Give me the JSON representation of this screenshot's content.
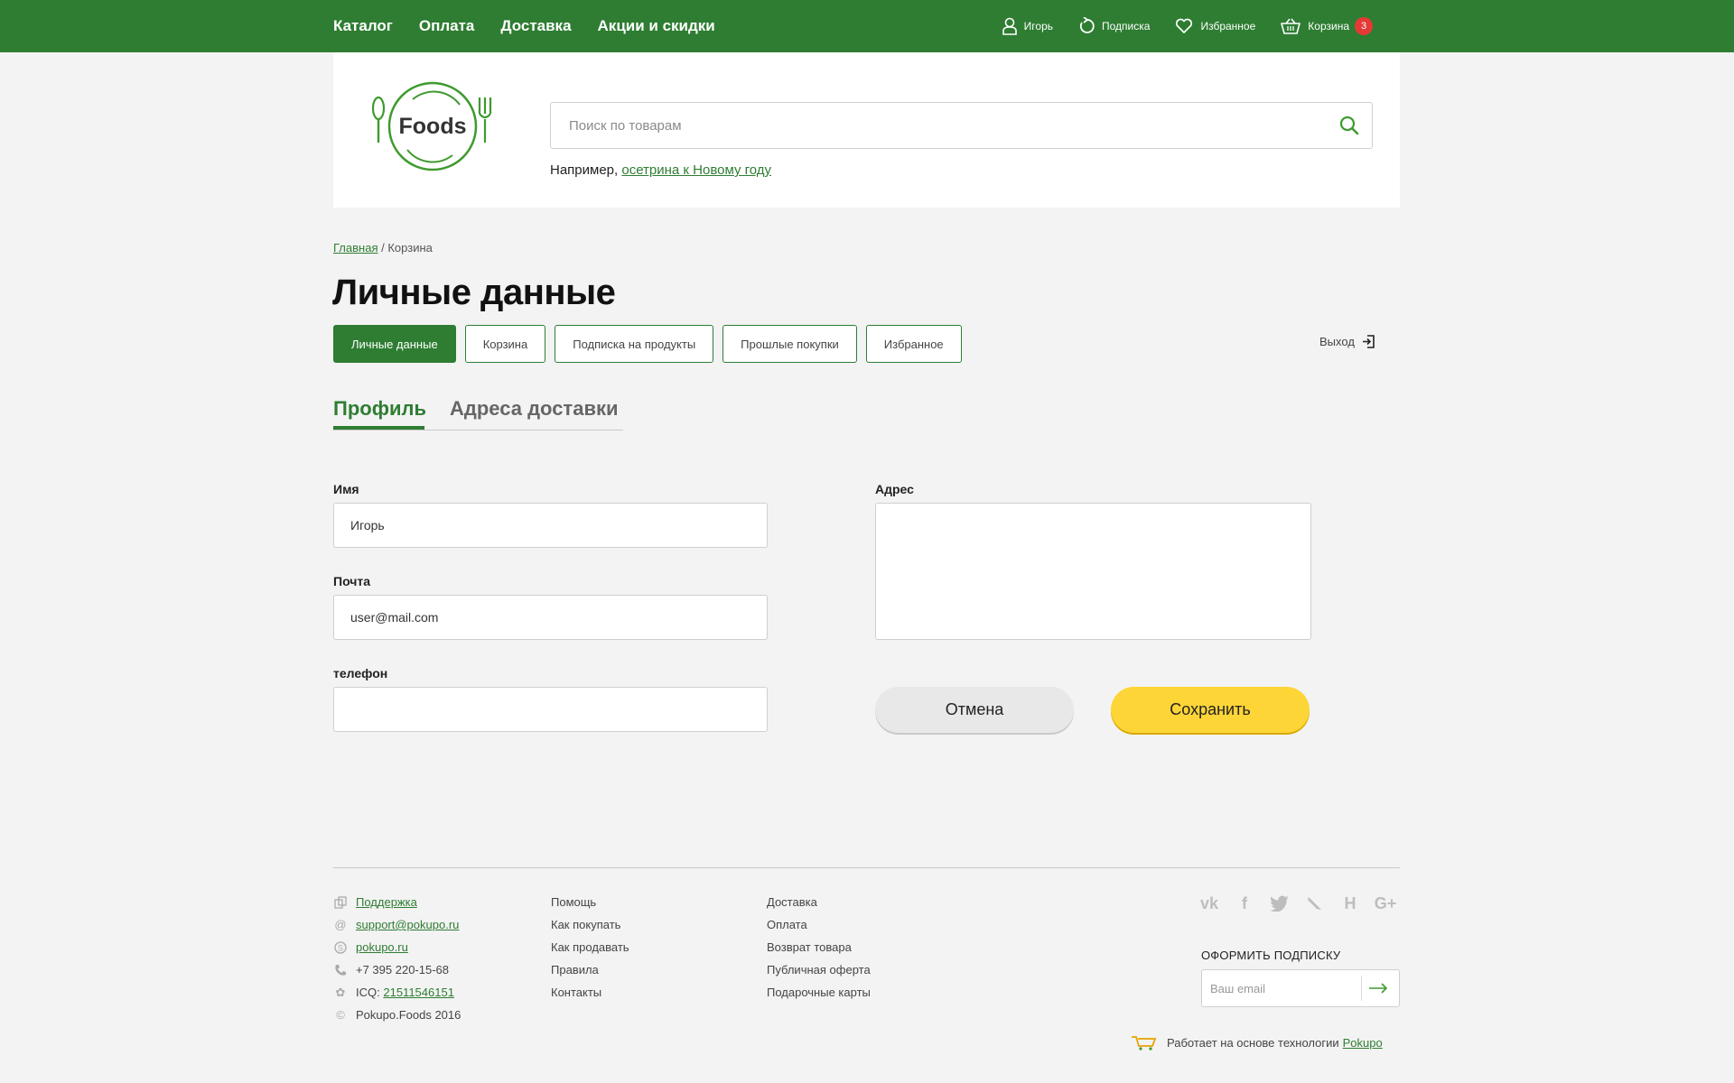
{
  "top_nav": {
    "items": [
      "Каталог",
      "Оплата",
      "Доставка",
      "Акции и скидки"
    ],
    "user": "Игорь",
    "subscription": "Подписка",
    "favorites": "Избранное",
    "cart": "Корзина",
    "cart_count": "3"
  },
  "header": {
    "logo_text": "Foods",
    "search_placeholder": "Поиск по товарам",
    "hint_prefix": "Например,",
    "hint_link": "осетрина к Новому году"
  },
  "breadcrumb": {
    "home": "Главная",
    "separator": "/",
    "current": "Корзина"
  },
  "page_title": "Личные данные",
  "account_tabs": [
    "Личные данные",
    "Корзина",
    "Подписка на продукты",
    "Прошлые покупки",
    "Избранное"
  ],
  "logout_label": "Выход",
  "sub_tabs": [
    "Профиль",
    "Адреса доставки"
  ],
  "form": {
    "name_label": "Имя",
    "name_value": "Игорь",
    "email_label": "Почта",
    "email_value": "user@mail.com",
    "phone_label": "телефон",
    "phone_value": "",
    "address_label": "Адрес",
    "address_value": "",
    "cancel_label": "Отмена",
    "save_label": "Сохранить"
  },
  "footer": {
    "contacts": {
      "support": "Поддержка",
      "email": "support@pokupo.ru",
      "site": "pokupo.ru",
      "phone": "+7 395 220-15-68",
      "icq_label": "ICQ:",
      "icq_number": "21511546151",
      "copyright": "Pokupo.Foods 2016"
    },
    "col2": [
      "Помощь",
      "Как покупать",
      "Как продавать",
      "Правила",
      "Контакты"
    ],
    "col3": [
      "Доставка",
      "Оплата",
      "Возврат товара",
      "Публичная оферта",
      "Подарочные карты"
    ],
    "socials": [
      "vk-icon",
      "facebook-icon",
      "twitter-icon",
      "livejournal-icon",
      "habr-icon",
      "google-plus-icon"
    ],
    "subscribe_title": "ОФОРМИТЬ ПОДПИСКУ",
    "email_placeholder": "Ваш email",
    "powered_text": "Работает на основе технологии",
    "powered_link": "Pokupo"
  },
  "colors": {
    "brand_green": "#2e7d32",
    "accent_yellow": "#fdd537",
    "badge_red": "#e53935"
  }
}
